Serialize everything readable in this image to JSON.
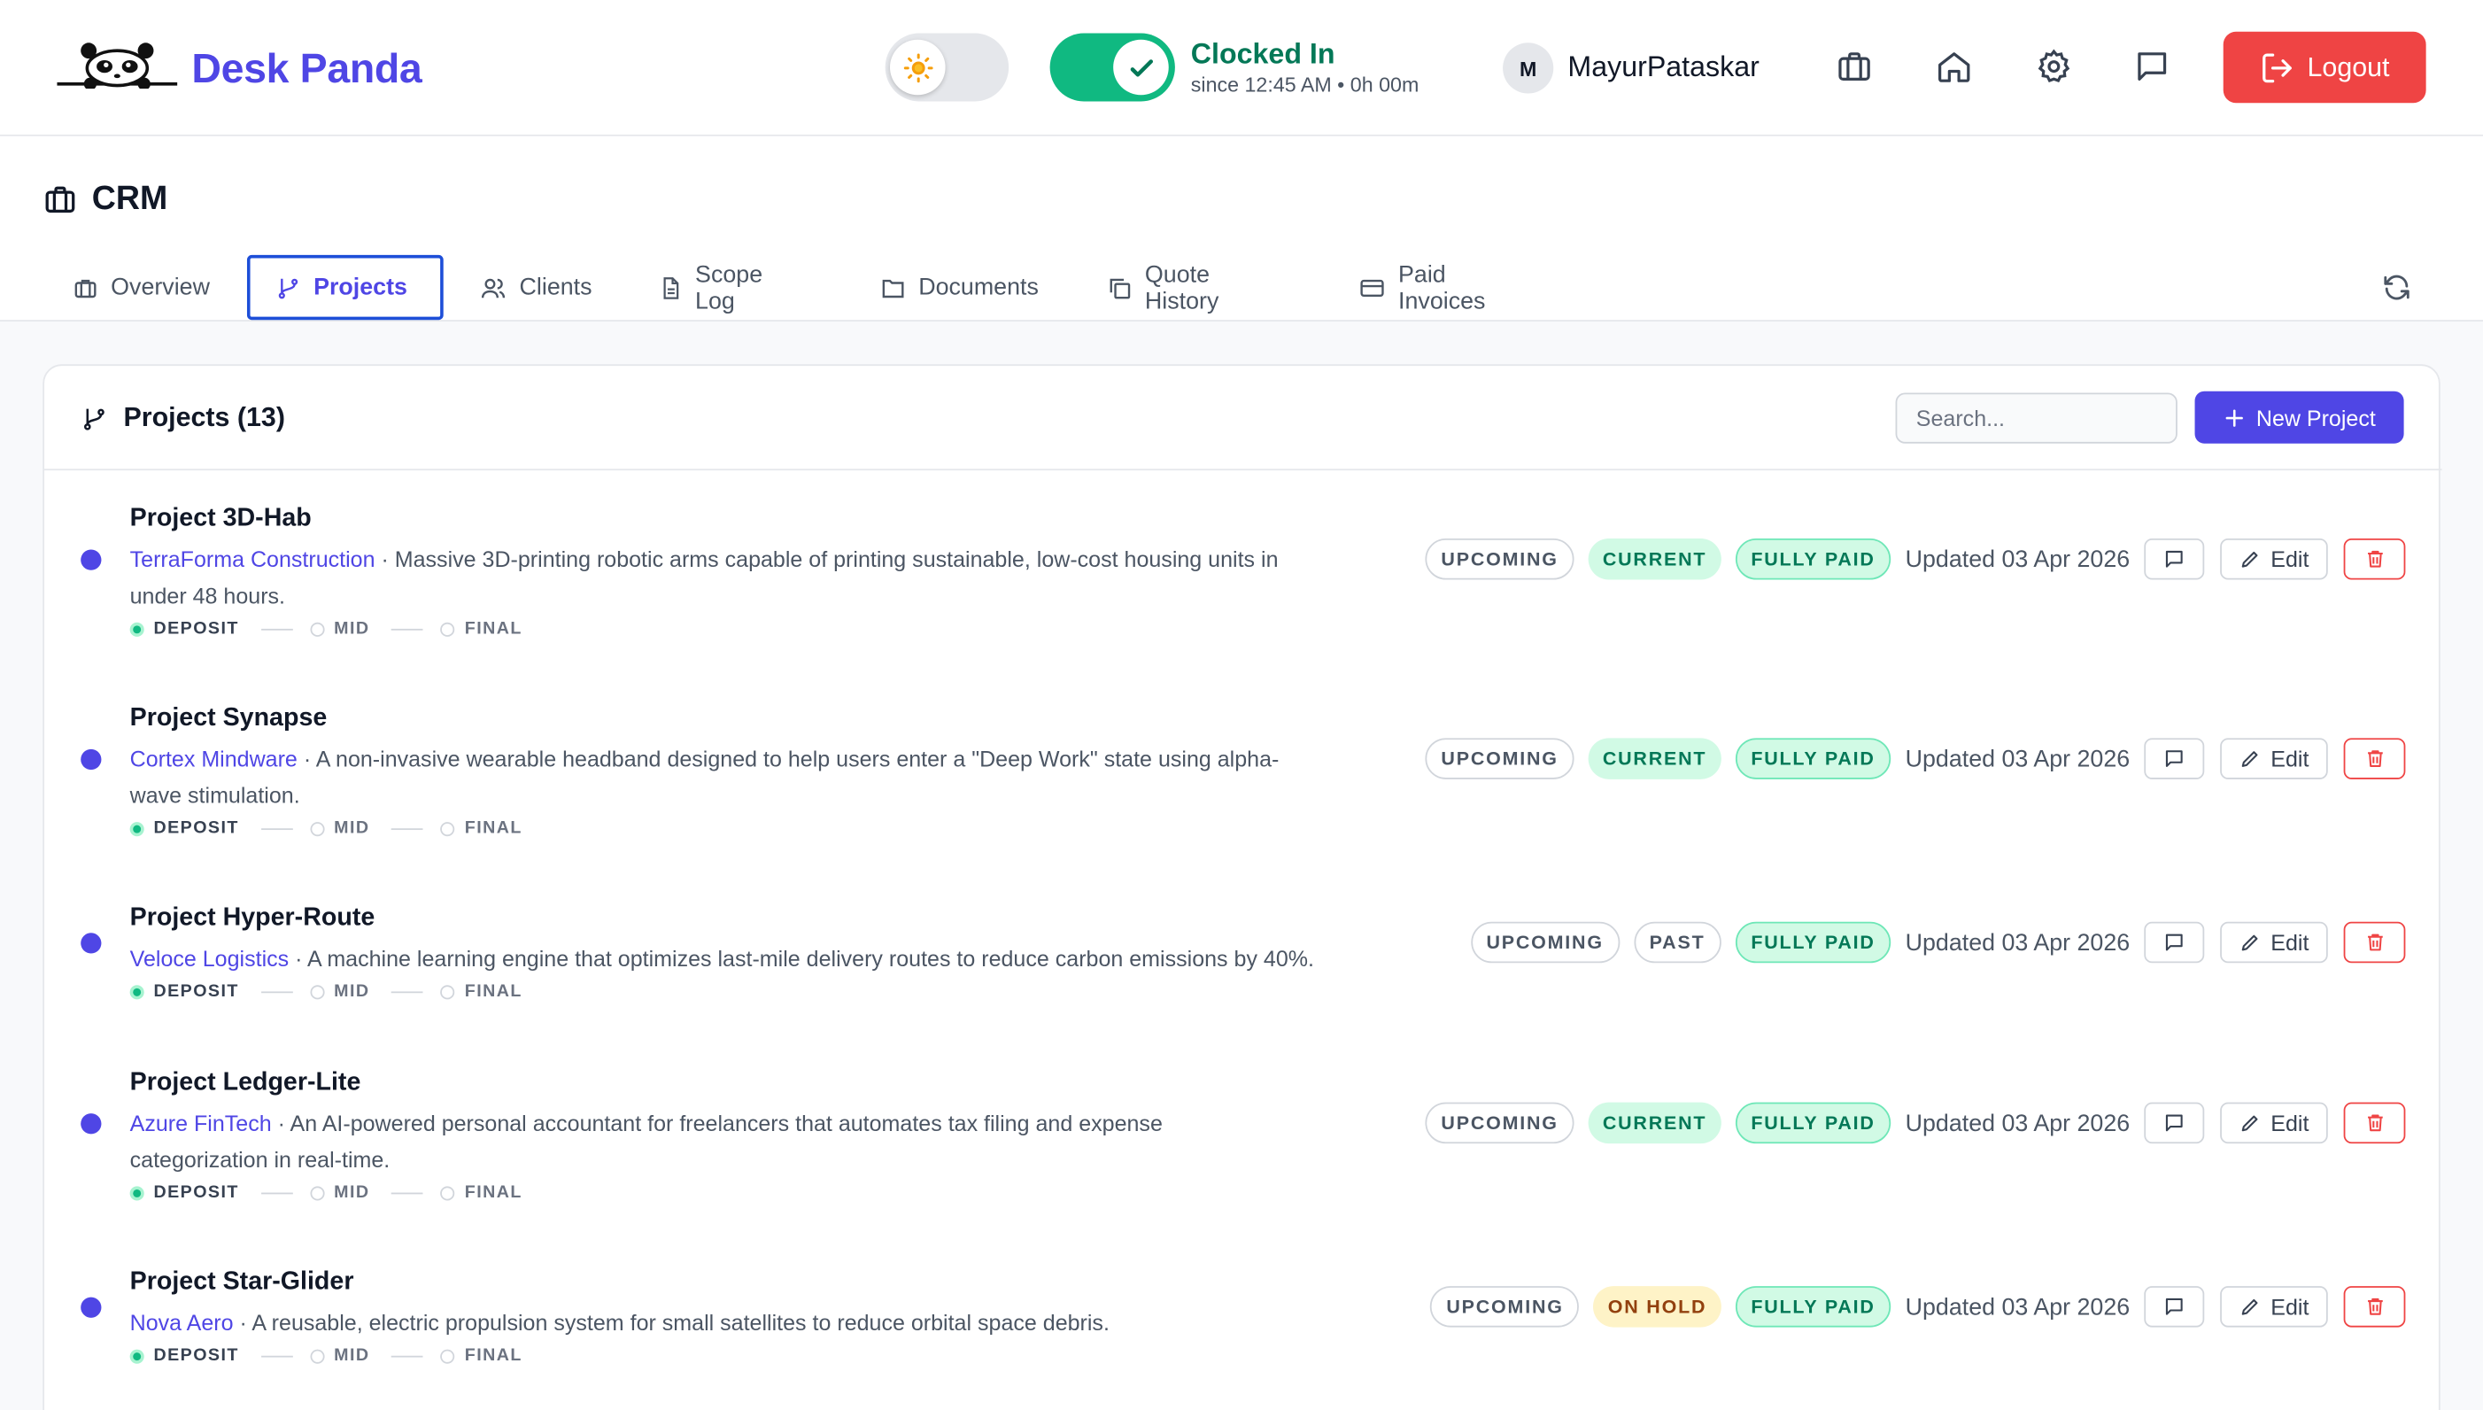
{
  "header": {
    "brand": "Desk Panda",
    "clock_status": "Clocked In",
    "clock_since": "since 12:45 AM • 0h 00m",
    "avatar_initial": "M",
    "username": "MayurPataskar",
    "logout_label": "Logout"
  },
  "page": {
    "title": "CRM",
    "tabs": [
      {
        "label": "Overview",
        "icon": "briefcase-icon"
      },
      {
        "label": "Projects",
        "icon": "git-branch-icon"
      },
      {
        "label": "Clients",
        "icon": "users-icon"
      },
      {
        "label": "Scope Log",
        "icon": "document-icon"
      },
      {
        "label": "Documents",
        "icon": "folder-icon"
      },
      {
        "label": "Quote History",
        "icon": "copy-icon"
      },
      {
        "label": "Paid Invoices",
        "icon": "credit-card-icon"
      }
    ],
    "active_tab": "Projects"
  },
  "projects": {
    "title": "Projects (13)",
    "search_placeholder": "Search...",
    "new_button": "New Project",
    "milestone_labels": [
      "DEPOSIT",
      "MID",
      "FINAL"
    ],
    "edit_label": "Edit",
    "items": [
      {
        "name": "Project 3D-Hab",
        "client": "TerraForma Construction",
        "desc_line1": " · Massive 3D-printing robotic arms capable of printing sustainable, low-cost housing units in",
        "desc_line2": "under 48 hours.",
        "badges": [
          "UPCOMING",
          "CURRENT",
          "FULLY PAID"
        ],
        "updated": "Updated 03 Apr 2026"
      },
      {
        "name": "Project Synapse",
        "client": "Cortex Mindware",
        "desc_line1": " · A non-invasive wearable headband designed to help users enter a \"Deep Work\" state using alpha-",
        "desc_line2": "wave stimulation.",
        "badges": [
          "UPCOMING",
          "CURRENT",
          "FULLY PAID"
        ],
        "updated": "Updated 03 Apr 2026"
      },
      {
        "name": "Project Hyper-Route",
        "client": "Veloce Logistics",
        "desc_line1": " · A machine learning engine that optimizes last-mile delivery routes to reduce carbon emissions by 40%.",
        "desc_line2": "",
        "badges": [
          "UPCOMING",
          "PAST",
          "FULLY PAID"
        ],
        "updated": "Updated 03 Apr 2026"
      },
      {
        "name": "Project Ledger-Lite",
        "client": "Azure FinTech",
        "desc_line1": " · An AI-powered personal accountant for freelancers that automates tax filing and expense",
        "desc_line2": "categorization in real-time.",
        "badges": [
          "UPCOMING",
          "CURRENT",
          "FULLY PAID"
        ],
        "updated": "Updated 03 Apr 2026"
      },
      {
        "name": "Project Star-Glider",
        "client": "Nova Aero",
        "desc_line1": " · A reusable, electric propulsion system for small satellites to reduce orbital space debris.",
        "desc_line2": "",
        "badges": [
          "UPCOMING",
          "ON HOLD",
          "FULLY PAID"
        ],
        "updated": "Updated 03 Apr 2026"
      }
    ]
  },
  "colors": {
    "brand": "#4f46e5",
    "clocked_in": "#10b981",
    "logout": "#ef4444"
  }
}
